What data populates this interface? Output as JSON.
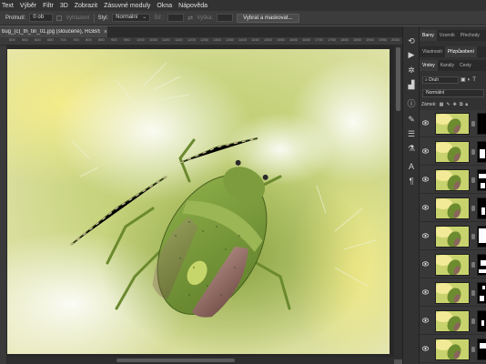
{
  "menu": {
    "items": [
      "Text",
      "Výběr",
      "Filtr",
      "3D",
      "Zobrazit",
      "Zásuvné moduly",
      "Okna",
      "Nápověda"
    ]
  },
  "options": {
    "feather_label": "Prolnutí:",
    "feather_value": "0 ob",
    "antialias_label": "Vyhlazení",
    "style_label": "Styl:",
    "style_value": "Normální",
    "width_label": "Šíř.:",
    "height_label": "Výška:",
    "select_mask_button": "Vybrat a maskovat..."
  },
  "document": {
    "tab_title": "bug_(c)_th_tin_01.jpg (sloučené), RGB/8*) *",
    "close_glyph": "×"
  },
  "ruler": {
    "ticks": [
      "500",
      "550",
      "600",
      "650",
      "700",
      "750",
      "800",
      "850",
      "900",
      "950",
      "1000",
      "1050",
      "1100",
      "1150",
      "1200",
      "1250",
      "1300",
      "1350",
      "1400",
      "1450",
      "1500",
      "1550",
      "1600",
      "1650",
      "1700",
      "1750",
      "1800",
      "1850",
      "1900",
      "1950",
      "2000"
    ]
  },
  "panels": {
    "top_tabs": [
      "Barvy",
      "Vzorník",
      "Přechody"
    ],
    "mid_tabs": [
      "Vlastnosti",
      "Přizpůsobení"
    ],
    "layer_tabs": [
      "Vrstvy",
      "Kanály",
      "Cesty"
    ],
    "kind_filter": "Druh",
    "blend_mode": "Normální",
    "lock_label": "Zámek:"
  },
  "layers": {
    "count": 9,
    "visible": [
      true,
      true,
      true,
      true,
      true,
      true,
      true,
      true,
      true
    ]
  },
  "colors": {
    "menubar": "#323232",
    "workspace": "#282828",
    "panel": "#323232",
    "accent": "#ffffff"
  },
  "icons": [
    "eye-icon",
    "move-icon",
    "lasso-icon",
    "brush-icon",
    "info-icon",
    "adjust-icon",
    "paragraph-icon",
    "character-icon",
    "lock-icon",
    "search-icon"
  ]
}
